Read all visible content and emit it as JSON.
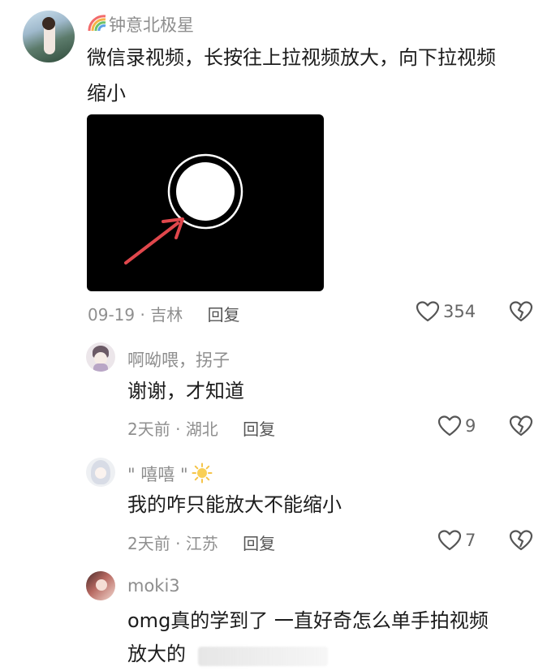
{
  "comments": [
    {
      "username": "钟意北极星",
      "text_lines": [
        "微信录视频，长按往上拉视频放大，向下拉视频",
        "缩小"
      ],
      "date": "09-19",
      "location": "吉林",
      "reply_label": "回复",
      "likes": "354"
    },
    {
      "username": "啊呦喂，拐子",
      "text_lines": [
        "谢谢，才知道"
      ],
      "date": "2天前",
      "location": "湖北",
      "reply_label": "回复",
      "likes": "9"
    },
    {
      "username": "\" 嘻嘻 \"",
      "text_lines": [
        "我的咋只能放大不能缩小"
      ],
      "date": "2天前",
      "location": "江苏",
      "reply_label": "回复",
      "likes": "7"
    },
    {
      "username": "moki3",
      "text_lines": [
        "omg真的学到了 一直好奇怎么单手拍视频",
        "放大的"
      ]
    }
  ],
  "colors": {
    "arrow": "#e0474c",
    "name": "#8e8e8e",
    "meta": "#8f8f8f"
  },
  "icons": [
    "rainbow-icon",
    "sun-icon",
    "heart-icon",
    "broken-heart-icon"
  ]
}
